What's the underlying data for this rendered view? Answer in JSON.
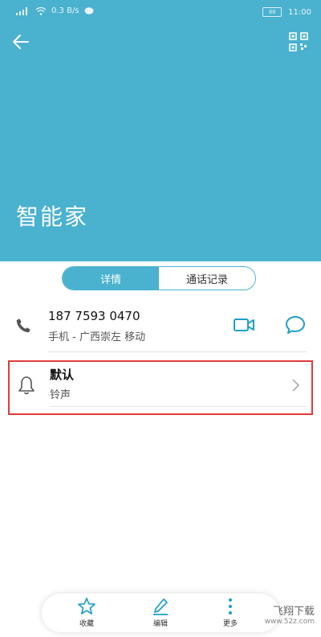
{
  "status": {
    "left_text": "ᵍ .ıl ≋ ◘",
    "speed": "0.3 B/s",
    "battery": "88",
    "time": "11:00"
  },
  "contact": {
    "name": "智能家"
  },
  "tabs": [
    {
      "label": "详情"
    },
    {
      "label": "通话记录"
    }
  ],
  "phone": {
    "number": "187 7593 0470",
    "subtitle": "手机 - 广西崇左 移动"
  },
  "ringtone": {
    "title": "默认",
    "subtitle": "铃声"
  },
  "bottom_bar": {
    "favorite": "收藏",
    "edit": "编辑",
    "more": "更多"
  },
  "watermark": {
    "brand": "飞翔下载",
    "url": "www.52z.com"
  },
  "colors": {
    "accent": "#4ab1cf",
    "highlight": "#e03a3a"
  },
  "icons": [
    "back-arrow-icon",
    "qr-code-icon",
    "phone-icon",
    "video-call-icon",
    "message-icon",
    "bell-icon",
    "chevron-right-icon",
    "star-icon",
    "pen-icon",
    "more-vertical-icon"
  ]
}
